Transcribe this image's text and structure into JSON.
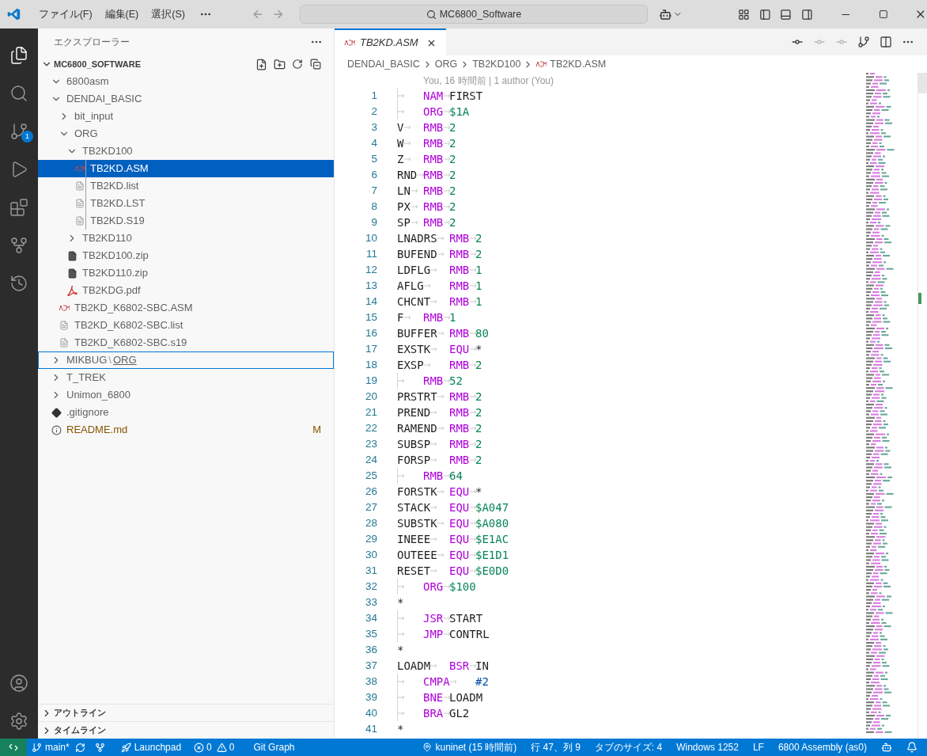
{
  "title_bar": {
    "menus": [
      "ファイル(F)",
      "編集(E)",
      "選択(S)"
    ],
    "search": {
      "value": "MC6800_Software"
    }
  },
  "activity_bar": {
    "badge": "1"
  },
  "sidebar": {
    "title": "エクスプローラー",
    "root": {
      "name": "MC6800_SOFTWARE",
      "expanded": true,
      "children": [
        {
          "name": "6800asm",
          "kind": "folder",
          "expanded": true
        },
        {
          "name": "DENDAI_BASIC",
          "kind": "folder",
          "expanded": true,
          "children": [
            {
              "name": "bit_input",
              "kind": "folder",
              "expanded": false
            },
            {
              "name": "ORG",
              "kind": "folder",
              "expanded": true,
              "children": [
                {
                  "name": "TB2KD100",
                  "kind": "folder",
                  "expanded": true,
                  "children": [
                    {
                      "name": "TB2KD.ASM",
                      "kind": "asm",
                      "selected": true
                    },
                    {
                      "name": "TB2KD.list",
                      "kind": "text",
                      "selected": false
                    },
                    {
                      "name": "TB2KD.LST",
                      "kind": "text",
                      "selected": false
                    },
                    {
                      "name": "TB2KD.S19",
                      "kind": "text",
                      "selected": false
                    }
                  ]
                },
                {
                  "name": "TB2KD110",
                  "kind": "folder",
                  "expanded": false
                },
                {
                  "name": "TB2KD100.zip",
                  "kind": "zip",
                  "selected": false
                },
                {
                  "name": "TB2KD110.zip",
                  "kind": "zip",
                  "selected": false
                },
                {
                  "name": "TB2KDG.pdf",
                  "kind": "pdf",
                  "selected": false
                }
              ]
            },
            {
              "name": "TB2KD_K6802-SBC.ASM",
              "kind": "asm",
              "selected": false
            },
            {
              "name": "TB2KD_K6802-SBC.list",
              "kind": "text",
              "selected": false
            },
            {
              "name": "TB2KD_K6802-SBC.s19",
              "kind": "text",
              "selected": false
            }
          ]
        },
        {
          "name": "MIKBUG",
          "separator": "\\",
          "sub": "ORG",
          "kind": "folder",
          "expanded": false,
          "focused": true
        },
        {
          "name": "T_TREK",
          "kind": "folder",
          "expanded": false
        },
        {
          "name": "Unimon_6800",
          "kind": "folder",
          "expanded": false
        },
        {
          "name": ".gitignore",
          "kind": "git",
          "selected": false
        },
        {
          "name": "README.md",
          "kind": "info",
          "selected": false,
          "modified": true,
          "badge": "M"
        }
      ]
    },
    "panels": [
      {
        "title": "アウトライン",
        "expanded": false
      },
      {
        "title": "タイムライン",
        "expanded": false
      }
    ]
  },
  "editor": {
    "tab": {
      "label": "TB2KD.ASM",
      "preview": true
    },
    "breadcrumbs": [
      "DENDAI_BASIC",
      "ORG",
      "TB2KD100",
      "TB2KD.ASM"
    ],
    "blame": "You, 16 時間前 | 1 author (You)",
    "lines": [
      {
        "number": "1",
        "op": "NAM",
        "operand": "FIRST",
        "kind": "symbol"
      },
      {
        "number": "2",
        "op": "ORG",
        "operand": "$1A",
        "kind": "number"
      },
      {
        "number": "3",
        "label": "V",
        "op": "RMB",
        "operand": "2",
        "kind": "number"
      },
      {
        "number": "4",
        "label": "W",
        "op": "RMB",
        "operand": "2",
        "kind": "number"
      },
      {
        "number": "5",
        "label": "Z",
        "op": "RMB",
        "operand": "2",
        "kind": "number"
      },
      {
        "number": "6",
        "label": "RND",
        "op": "RMB",
        "operand": "2",
        "kind": "number"
      },
      {
        "number": "7",
        "label": "LN",
        "op": "RMB",
        "operand": "2",
        "kind": "number"
      },
      {
        "number": "8",
        "label": "PX",
        "op": "RMB",
        "operand": "2",
        "kind": "number"
      },
      {
        "number": "9",
        "label": "SP",
        "op": "RMB",
        "operand": "2",
        "kind": "number"
      },
      {
        "number": "10",
        "label": "LNADRS",
        "op": "RMB",
        "operand": "2",
        "kind": "number"
      },
      {
        "number": "11",
        "label": "BUFEND",
        "op": "RMB",
        "operand": "2",
        "kind": "number"
      },
      {
        "number": "12",
        "label": "LDFLG",
        "op": "RMB",
        "operand": "1",
        "kind": "number"
      },
      {
        "number": "13",
        "label": "AFLG",
        "op": "RMB",
        "operand": "1",
        "kind": "number"
      },
      {
        "number": "14",
        "label": "CHCNT",
        "op": "RMB",
        "operand": "1",
        "kind": "number"
      },
      {
        "number": "15",
        "label": "F",
        "op": "RMB",
        "operand": "1",
        "kind": "number"
      },
      {
        "number": "16",
        "label": "BUFFER",
        "op": "RMB",
        "operand": "80",
        "kind": "number"
      },
      {
        "number": "17",
        "label": "EXSTK",
        "op": "EQU",
        "operand": "*",
        "kind": "symbol"
      },
      {
        "number": "18",
        "label": "EXSP",
        "op": "RMB",
        "operand": "2",
        "kind": "number"
      },
      {
        "number": "19",
        "op": "RMB",
        "operand": "52",
        "kind": "number"
      },
      {
        "number": "20",
        "label": "PRSTRT",
        "op": "RMB",
        "operand": "2",
        "kind": "number"
      },
      {
        "number": "21",
        "label": "PREND",
        "op": "RMB",
        "operand": "2",
        "kind": "number"
      },
      {
        "number": "22",
        "label": "RAMEND",
        "op": "RMB",
        "operand": "2",
        "kind": "number"
      },
      {
        "number": "23",
        "label": "SUBSP",
        "op": "RMB",
        "operand": "2",
        "kind": "number"
      },
      {
        "number": "24",
        "label": "FORSP",
        "op": "RMB",
        "operand": "2",
        "kind": "number"
      },
      {
        "number": "25",
        "op": "RMB",
        "operand": "64",
        "kind": "number"
      },
      {
        "number": "26",
        "label": "FORSTK",
        "op": "EQU",
        "operand": "*",
        "kind": "symbol"
      },
      {
        "number": "27",
        "label": "STACK",
        "op": "EQU",
        "operand": "$A047",
        "kind": "number"
      },
      {
        "number": "28",
        "label": "SUBSTK",
        "op": "EQU",
        "operand": "$A080",
        "kind": "number"
      },
      {
        "number": "29",
        "label": "INEEE",
        "op": "EQU",
        "operand": "$E1AC",
        "kind": "number"
      },
      {
        "number": "30",
        "label": "OUTEEE",
        "op": "EQU",
        "operand": "$E1D1",
        "kind": "number"
      },
      {
        "number": "31",
        "label": "RESET",
        "op": "EQU",
        "operand": "$E0D0",
        "kind": "number"
      },
      {
        "number": "32",
        "op": "ORG",
        "operand": "$100",
        "kind": "number"
      },
      {
        "number": "33",
        "label": "*",
        "kind": "comment"
      },
      {
        "number": "34",
        "op": "JSR",
        "operand": "START",
        "kind": "symbol"
      },
      {
        "number": "35",
        "op": "JMP",
        "operand": "CONTRL",
        "kind": "symbol"
      },
      {
        "number": "36",
        "label": "*",
        "kind": "comment"
      },
      {
        "number": "37",
        "label": "LOADM",
        "op": "BSR",
        "operand": "IN",
        "kind": "symbol"
      },
      {
        "number": "38",
        "op": "CMPA",
        "operand": "#2",
        "kind": "immediate"
      },
      {
        "number": "39",
        "op": "BNE",
        "operand": "LOADM",
        "kind": "symbol"
      },
      {
        "number": "40",
        "op": "BRA",
        "operand": "GL2",
        "kind": "symbol"
      },
      {
        "number": "41",
        "label": "*",
        "kind": "comment"
      }
    ]
  },
  "status_bar": {
    "branch": "main*",
    "launchpad": "Launchpad",
    "errors": "0",
    "warnings": "0",
    "git_graph": "Git Graph",
    "right": [
      "kuninet (15 時間前)",
      "行 47、列 9",
      "タブのサイズ: 4",
      "Windows 1252",
      "LF",
      "6800 Assembly (as0)"
    ]
  }
}
